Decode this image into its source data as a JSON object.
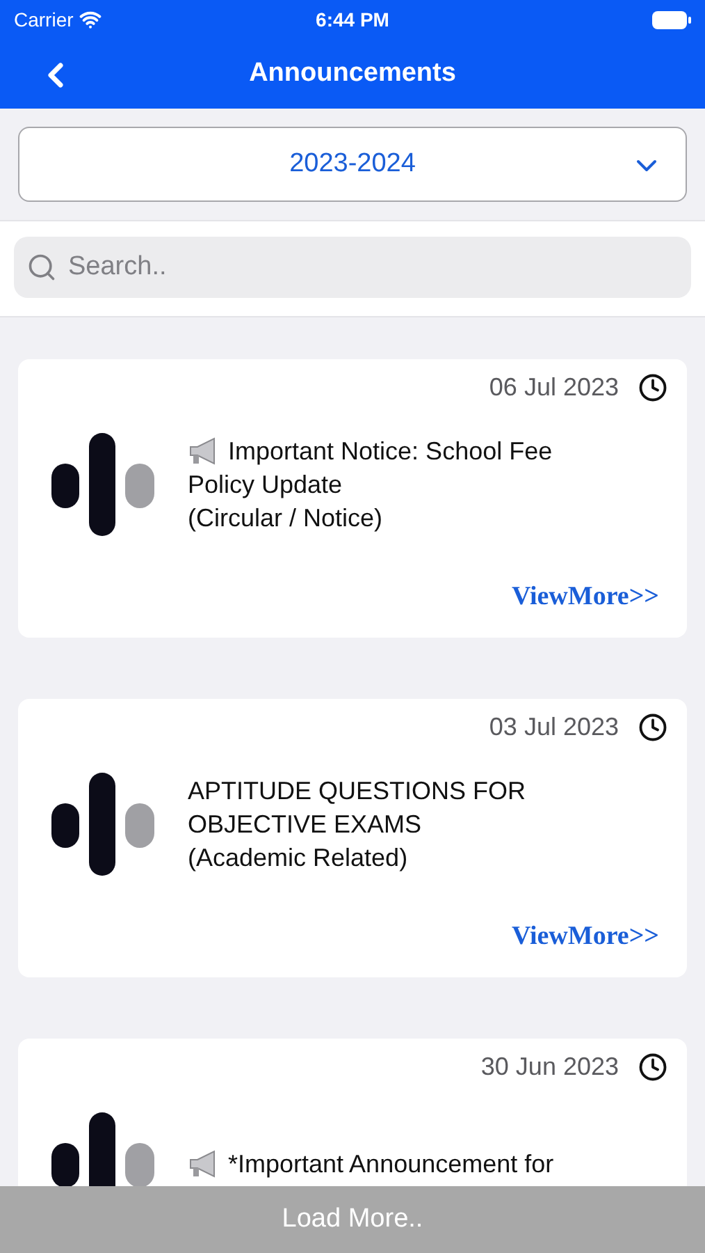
{
  "status_bar": {
    "carrier": "Carrier",
    "time": "6:44 PM"
  },
  "nav": {
    "title": "Announcements"
  },
  "year_picker": {
    "value": "2023-2024"
  },
  "search": {
    "placeholder": "Search.."
  },
  "announcements": [
    {
      "date": "06 Jul 2023",
      "lines": [
        [
          {
            "kind": "megaphone"
          },
          {
            "kind": "text",
            "text": "Important Notice: School Fee"
          }
        ],
        [
          {
            "kind": "text",
            "text": "Policy Update"
          }
        ],
        [
          {
            "kind": "text",
            "text": "(Circular / Notice)"
          }
        ]
      ],
      "link": "ViewMore>>"
    },
    {
      "date": "03 Jul 2023",
      "lines": [
        [
          {
            "kind": "text",
            "text": "APTITUDE QUESTIONS FOR"
          }
        ],
        [
          {
            "kind": "text",
            "text": "OBJECTIVE EXAMS"
          }
        ],
        [
          {
            "kind": "text",
            "text": "(Academic Related)"
          }
        ]
      ],
      "link": "ViewMore>>"
    },
    {
      "date": "30 Jun 2023",
      "lines": [
        [
          {
            "kind": "megaphone"
          },
          {
            "kind": "text",
            "text": "*Important Announcement for"
          }
        ]
      ]
    }
  ],
  "load_more": "Load More.."
}
